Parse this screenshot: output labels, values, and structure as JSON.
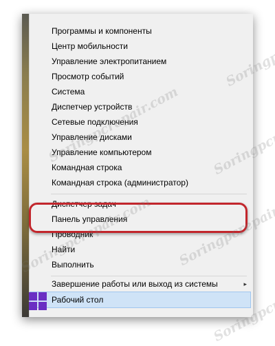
{
  "menu": {
    "items": [
      {
        "label": "Программы и компоненты"
      },
      {
        "label": "Центр мобильности"
      },
      {
        "label": "Управление электропитанием"
      },
      {
        "label": "Просмотр событий"
      },
      {
        "label": "Система"
      },
      {
        "label": "Диспетчер устройств"
      },
      {
        "label": "Сетевые подключения"
      },
      {
        "label": "Управление дисками"
      },
      {
        "label": "Управление компьютером"
      },
      {
        "label": "Командная строка"
      },
      {
        "label": "Командная строка (администратор)"
      },
      {
        "label": "Диспетчер задач"
      },
      {
        "label": "Панель управления"
      },
      {
        "label": "Проводник"
      },
      {
        "label": "Найти"
      },
      {
        "label": "Выполнить"
      },
      {
        "label": "Завершение работы или выход из системы",
        "submenu_arrow": "▸"
      },
      {
        "label": "Рабочий стол"
      }
    ]
  },
  "watermark": {
    "text": "Soringpcrepair.com"
  },
  "colors": {
    "highlight_box": "#c2262c",
    "start_logo": "#6a2fc3",
    "hover": "#cfe3f7"
  },
  "icons": {
    "start": "windows-logo-icon"
  }
}
